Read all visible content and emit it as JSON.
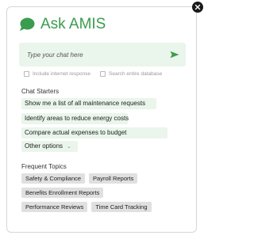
{
  "header": {
    "title": "Ask AMIS",
    "icon": "chat-bubble-icon",
    "accent_color": "#3a9c4e"
  },
  "chat": {
    "placeholder": "Type your chat here",
    "send_icon": "send-arrow-icon"
  },
  "options": [
    {
      "label": "Include internet response",
      "checked": false
    },
    {
      "label": "Search entire database",
      "checked": false
    }
  ],
  "chat_starters": {
    "heading": "Chat Starters",
    "items": [
      "Show me a list of all maintenance requests",
      "Identify areas to reduce energy costs",
      "Compare actual expenses to budget"
    ],
    "more_label": "Other options"
  },
  "frequent_topics": {
    "heading": "Frequent Topics",
    "items": [
      "Safety & Compliance",
      "Payroll Reports",
      "Benefits Enrollment Reports",
      "Performance Reviews",
      "Time Card Tracking"
    ]
  }
}
